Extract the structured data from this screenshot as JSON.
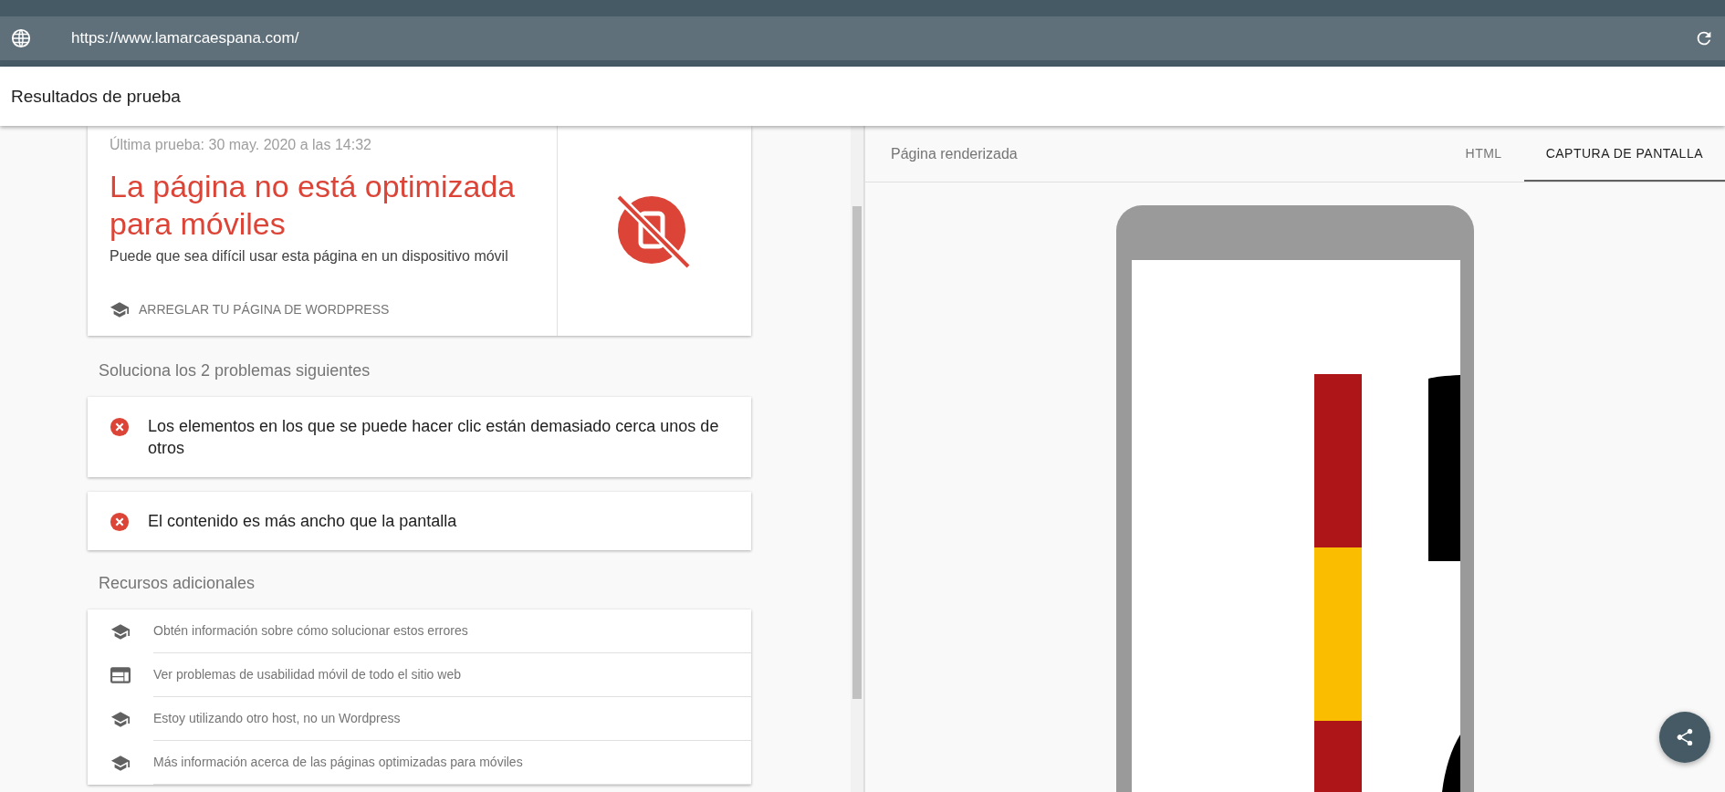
{
  "url_bar": {
    "url": "https://www.lamarcaespana.com/"
  },
  "header": {
    "title": "Resultados de prueba"
  },
  "result": {
    "last_test": "Última prueba: 30 may. 2020 a las 14:32",
    "verdict": "La página no está optimizada para móviles",
    "subtitle": "Puede que sea difícil usar esta página en un dispositivo móvil",
    "action": "ARREGLAR TU PÁGINA DE WORDPRESS"
  },
  "problems": {
    "heading": "Soluciona los 2 problemas siguientes",
    "items": [
      {
        "text": "Los elementos en los que se puede hacer clic están demasiado cerca unos de otros"
      },
      {
        "text": "El contenido es más ancho que la pantalla"
      }
    ]
  },
  "resources": {
    "heading": "Recursos adicionales",
    "items": [
      {
        "kind": "learn",
        "text": "Obtén información sobre cómo solucionar estos errores"
      },
      {
        "kind": "report",
        "text": "Ver problemas de usabilidad móvil de todo el sitio web"
      },
      {
        "kind": "learn",
        "text": "Estoy utilizando otro host, no un Wordpress"
      },
      {
        "kind": "learn",
        "text": "Más información acerca de las páginas optimizadas para móviles"
      }
    ]
  },
  "preview": {
    "title": "Página renderizada",
    "tabs": [
      {
        "label": "HTML",
        "selected": false
      },
      {
        "label": "CAPTURA DE PANTALLA",
        "selected": true
      }
    ]
  }
}
